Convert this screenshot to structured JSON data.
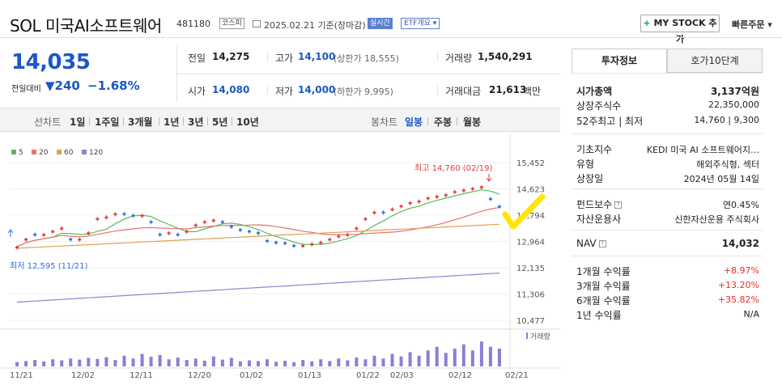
{
  "header": {
    "name": "SOL 미국AI소프트웨어",
    "code": "481180",
    "market_badge": "코스피",
    "date_info": "2025.02.21 기준(장마감)",
    "live_badge": "실시간",
    "etf_badge": "ETF개요 ▾",
    "mystock_label": "MY STOCK 추가",
    "quick_order": "빠른주문 ▾"
  },
  "quote": {
    "price": "14,035",
    "change_label": "전일대비",
    "change_value": "▼240",
    "change_pct": "−1.68%",
    "prev_label": "전일",
    "prev_value": "14,275",
    "high_label": "고가",
    "high_value": "14,100",
    "high_sub": "(상한가 18,555)",
    "volume_label": "거래량",
    "volume_value": "1,540,291",
    "open_label": "시가",
    "open_value": "14,080",
    "low_label": "저가",
    "low_value": "14,000",
    "low_sub": "(하한가 9,995)",
    "amount_label": "거래대금",
    "amount_value": "21,613",
    "amount_unit": "백만"
  },
  "tabs": {
    "line": "선차트",
    "periods": [
      "1일",
      "1주일",
      "3개월",
      "1년",
      "3년",
      "5년",
      "10년"
    ],
    "candle": "봉차트",
    "candle_periods": [
      "일봉",
      "주봉",
      "월봉"
    ],
    "active_candle": "일봉"
  },
  "legend": [
    {
      "label": "5",
      "color": "#5cb85c"
    },
    {
      "label": "20",
      "color": "#e57373"
    },
    {
      "label": "60",
      "color": "#e0a050"
    },
    {
      "label": "120",
      "color": "#9a7fd0"
    }
  ],
  "chart_data": {
    "type": "candlestick",
    "y_ticks": [
      "15,452",
      "14,623",
      "13,794",
      "12,964",
      "12,135",
      "11,306",
      "10,477"
    ],
    "ylim": [
      10477,
      15452
    ],
    "x_labels": [
      "11/21",
      "12/02",
      "12/11",
      "12/20",
      "01/02",
      "01/13",
      "01/22",
      "02/03",
      "02/12",
      "02/21"
    ],
    "high_annotation": "최고 14,760 (02/19)",
    "low_annotation": "최저 12,595 (11/21)",
    "volume_label": "거래량",
    "candles_close": [
      12800,
      13050,
      13150,
      13200,
      13300,
      13400,
      13000,
      13050,
      13250,
      13700,
      13750,
      13850,
      13800,
      13750,
      13800,
      13550,
      13150,
      13250,
      13150,
      13300,
      13500,
      13600,
      13650,
      13550,
      13400,
      13300,
      13250,
      13200,
      12950,
      12900,
      12880,
      12800,
      12850,
      12900,
      12950,
      13050,
      13150,
      13200,
      13400,
      13700,
      13900,
      13850,
      14000,
      14100,
      14200,
      14250,
      14350,
      14400,
      14450,
      14550,
      14600,
      14650,
      14700,
      14275,
      14035
    ],
    "candles_dir": [
      "u",
      "u",
      "d",
      "u",
      "u",
      "u",
      "d",
      "u",
      "u",
      "u",
      "u",
      "u",
      "d",
      "d",
      "u",
      "d",
      "d",
      "u",
      "d",
      "u",
      "u",
      "u",
      "u",
      "d",
      "d",
      "d",
      "d",
      "d",
      "d",
      "d",
      "d",
      "d",
      "u",
      "u",
      "u",
      "u",
      "u",
      "u",
      "u",
      "u",
      "u",
      "d",
      "u",
      "u",
      "u",
      "u",
      "u",
      "u",
      "u",
      "u",
      "u",
      "u",
      "u",
      "d",
      "d"
    ],
    "volume": [
      0.12,
      0.15,
      0.18,
      0.14,
      0.2,
      0.17,
      0.22,
      0.19,
      0.24,
      0.21,
      0.26,
      0.18,
      0.3,
      0.22,
      0.35,
      0.27,
      0.32,
      0.2,
      0.25,
      0.18,
      0.22,
      0.16,
      0.28,
      0.19,
      0.24,
      0.14,
      0.17,
      0.15,
      0.2,
      0.13,
      0.16,
      0.12,
      0.18,
      0.14,
      0.2,
      0.15,
      0.22,
      0.17,
      0.25,
      0.2,
      0.3,
      0.22,
      0.35,
      0.28,
      0.4,
      0.3,
      0.45,
      0.55,
      0.38,
      0.5,
      0.62,
      0.45,
      0.7,
      0.55,
      0.5
    ]
  },
  "info": {
    "tab_invest": "투자정보",
    "tab_orderbook": "호가10단계",
    "market_cap_label": "시가총액",
    "market_cap_value": "3,137억원",
    "shares_label": "상장주식수",
    "shares_value": "22,350,000",
    "w52_label": "52주최고 | 최저",
    "w52_value": "14,760 | 9,300",
    "index_label": "기초지수",
    "index_value": "KEDI 미국 AI 소프트웨어지…",
    "type_label": "유형",
    "type_value": "해외주식형, 섹터",
    "listing_label": "상장일",
    "listing_value": "2024년 05월 14일",
    "fee_label": "펀드보수",
    "fee_value": "연0.45%",
    "manager_label": "자산운용사",
    "manager_value": "신한자산운용 주식회사",
    "nav_label": "NAV",
    "nav_value": "14,032",
    "r1m_label": "1개월 수익률",
    "r1m_value": "+8.97%",
    "r3m_label": "3개월 수익률",
    "r3m_value": "+13.20%",
    "r6m_label": "6개월 수익률",
    "r6m_value": "+35.82%",
    "r1y_label": "1년 수익률",
    "r1y_value": "N/A"
  }
}
